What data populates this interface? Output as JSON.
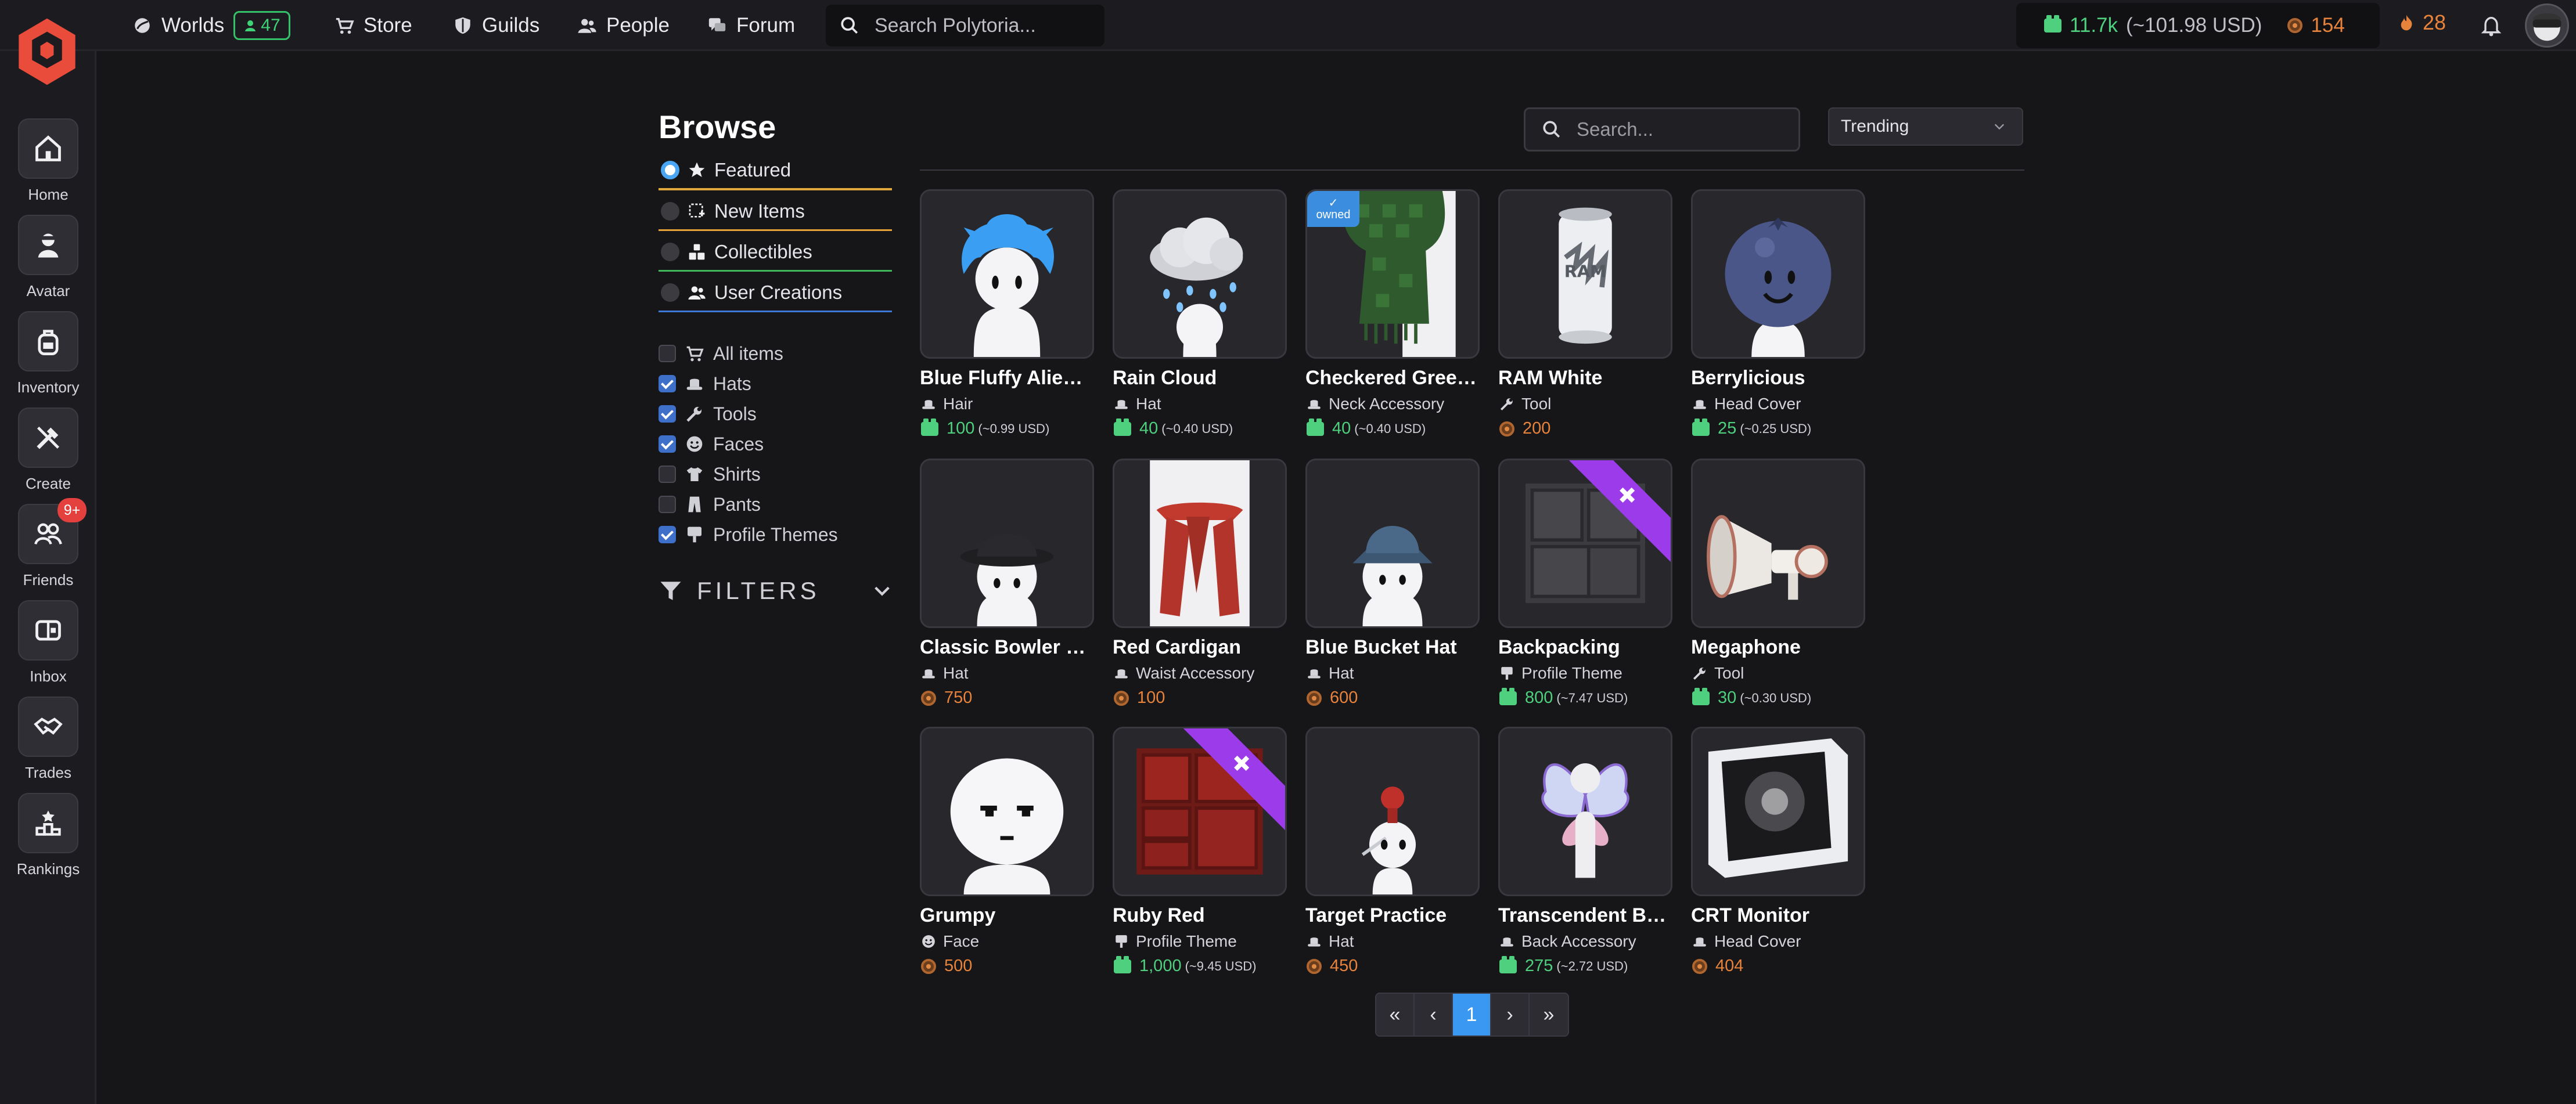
{
  "topbar": {
    "nav": {
      "worlds": "Worlds",
      "worlds_players": "47",
      "store": "Store",
      "guilds": "Guilds",
      "people": "People",
      "forum": "Forum"
    },
    "search_placeholder": "Search Polytoria...",
    "bricks": "11.7k",
    "bricks_usd": "(~101.98 USD)",
    "stars": "154",
    "streak": "28"
  },
  "sidebar": {
    "items": [
      {
        "label": "Home"
      },
      {
        "label": "Avatar"
      },
      {
        "label": "Inventory"
      },
      {
        "label": "Create"
      },
      {
        "label": "Friends",
        "badge": "9+"
      },
      {
        "label": "Inbox"
      },
      {
        "label": "Trades"
      },
      {
        "label": "Rankings"
      }
    ]
  },
  "browse": {
    "title": "Browse",
    "categories": [
      {
        "label": "Featured",
        "selected": true,
        "color": "#e0a83a"
      },
      {
        "label": "New Items",
        "selected": false,
        "color": "#e4a438"
      },
      {
        "label": "Collectibles",
        "selected": false,
        "color": "#3fb65a"
      },
      {
        "label": "User Creations",
        "selected": false,
        "color": "#3e78d8"
      }
    ],
    "types": [
      {
        "label": "All items",
        "checked": false
      },
      {
        "label": "Hats",
        "checked": true
      },
      {
        "label": "Tools",
        "checked": true
      },
      {
        "label": "Faces",
        "checked": true
      },
      {
        "label": "Shirts",
        "checked": false
      },
      {
        "label": "Pants",
        "checked": false
      },
      {
        "label": "Profile Themes",
        "checked": true
      }
    ],
    "filters_label": "FILTERS"
  },
  "controls": {
    "search_placeholder": "Search...",
    "sort": "Trending"
  },
  "items": [
    {
      "name": "Blue Fluffy Alien ...",
      "type": "Hair",
      "price": "100",
      "usd": "(~0.99 USD)",
      "currency": "bricks"
    },
    {
      "name": "Rain Cloud",
      "type": "Hat",
      "price": "40",
      "usd": "(~0.40 USD)",
      "currency": "bricks"
    },
    {
      "name": "Checkered Green...",
      "type": "Neck Accessory",
      "price": "40",
      "usd": "(~0.40 USD)",
      "currency": "bricks",
      "owned": "owned"
    },
    {
      "name": "RAM White",
      "type": "Tool",
      "price": "200",
      "usd": "",
      "currency": "stars"
    },
    {
      "name": "Berrylicious",
      "type": "Head Cover",
      "price": "25",
      "usd": "(~0.25 USD)",
      "currency": "bricks"
    },
    {
      "name": "Classic Bowler Hat",
      "type": "Hat",
      "price": "750",
      "usd": "",
      "currency": "stars"
    },
    {
      "name": "Red Cardigan",
      "type": "Waist Accessory",
      "price": "100",
      "usd": "",
      "currency": "stars"
    },
    {
      "name": "Blue Bucket Hat",
      "type": "Hat",
      "price": "600",
      "usd": "",
      "currency": "stars"
    },
    {
      "name": "Backpacking",
      "type": "Profile Theme",
      "price": "800",
      "usd": "(~7.47 USD)",
      "currency": "bricks"
    },
    {
      "name": "Megaphone",
      "type": "Tool",
      "price": "30",
      "usd": "(~0.30 USD)",
      "currency": "bricks"
    },
    {
      "name": "Grumpy",
      "type": "Face",
      "price": "500",
      "usd": "",
      "currency": "stars"
    },
    {
      "name": "Ruby Red",
      "type": "Profile Theme",
      "price": "1,000",
      "usd": "(~9.45 USD)",
      "currency": "bricks"
    },
    {
      "name": "Target Practice",
      "type": "Hat",
      "price": "450",
      "usd": "",
      "currency": "stars"
    },
    {
      "name": "Transcendent But...",
      "type": "Back Accessory",
      "price": "275",
      "usd": "(~2.72 USD)",
      "currency": "bricks"
    },
    {
      "name": "CRT Monitor",
      "type": "Head Cover",
      "price": "404",
      "usd": "",
      "currency": "stars"
    }
  ],
  "pagination": {
    "first": "«",
    "prev": "‹",
    "current": "1",
    "next": "›",
    "last": "»"
  }
}
